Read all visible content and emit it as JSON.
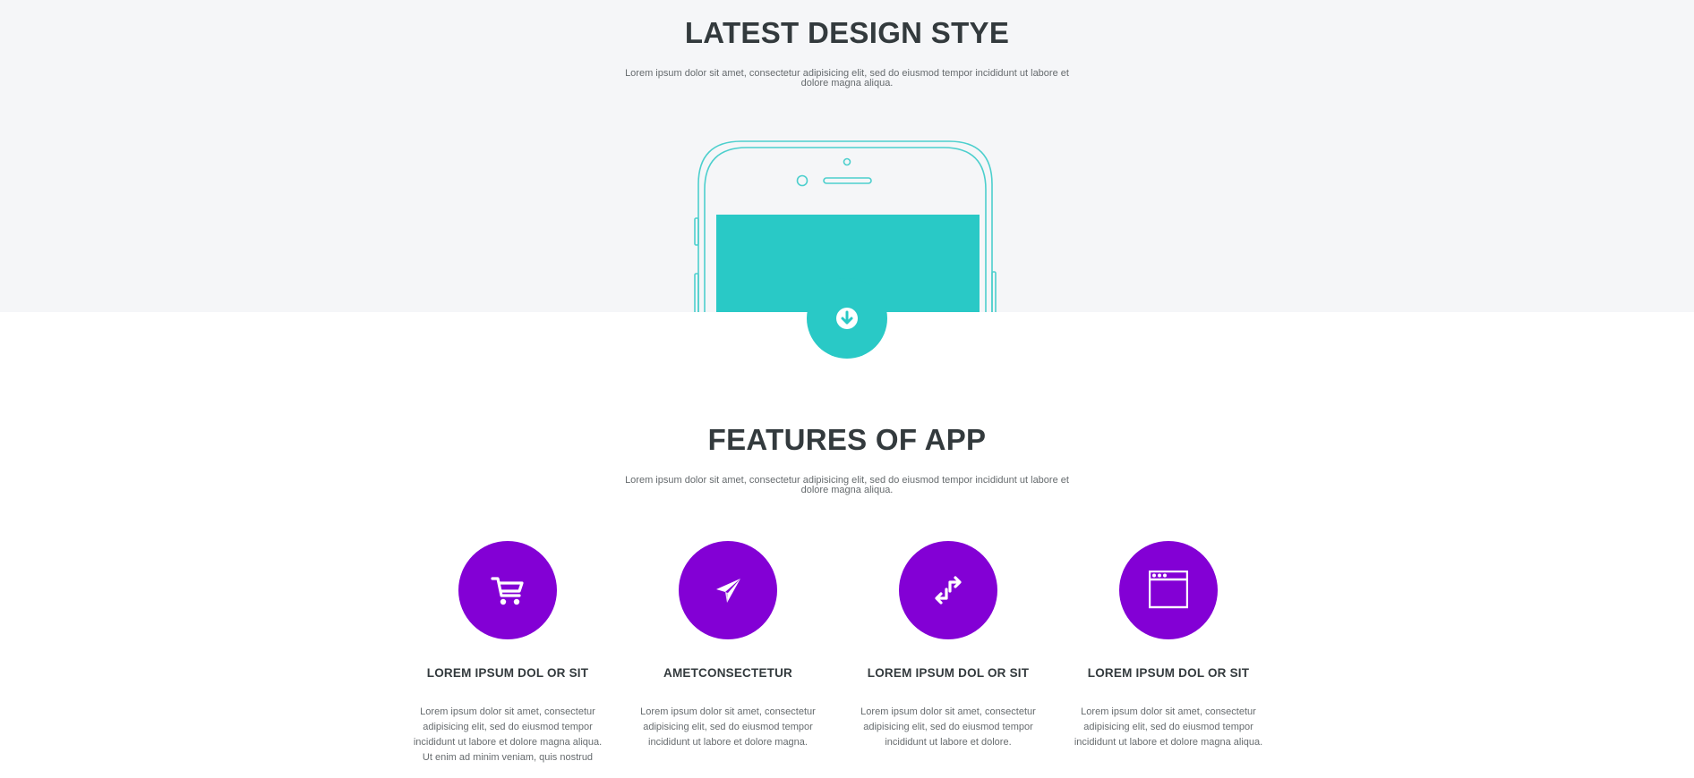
{
  "hero": {
    "title": "LATEST DESIGN STYE",
    "description": "Lorem ipsum dolor sit amet, consectetur adipisicing elit, sed do eiusmod tempor incididunt ut labore et dolore magna aliqua.",
    "phone_icon": "smartphone-outline-illustration",
    "scroll_icon": "arrow-down-circle-icon"
  },
  "features": {
    "title": "FEATURES OF APP",
    "description": "Lorem ipsum dolor sit amet, consectetur adipisicing elit, sed do eiusmod tempor incididunt ut labore et dolore magna aliqua.",
    "items": [
      {
        "icon": "shopping-cart-icon",
        "title": "LOREM IPSUM DOL OR SIT",
        "text": "Lorem ipsum dolor sit amet, consectetur adipisicing elit, sed do eiusmod tempor incididunt ut labore et dolore magna aliqua. Ut enim ad minim veniam, quis nostrud"
      },
      {
        "icon": "paper-plane-icon",
        "title": "AMETCONSECTETUR",
        "text": "Lorem ipsum dolor sit amet, consectetur adipisicing elit, sed do eiusmod tempor incididunt ut labore et dolore magna."
      },
      {
        "icon": "exchange-arrows-icon",
        "title": "LOREM IPSUM DOL OR SIT",
        "text": "Lorem ipsum dolor sit amet, consectetur adipisicing elit, sed do eiusmod tempor incididunt ut labore et dolore."
      },
      {
        "icon": "browser-window-icon",
        "title": "LOREM IPSUM DOL OR SIT",
        "text": "Lorem ipsum dolor sit amet, consectetur adipisicing elit, sed do eiusmod tempor incididunt ut labore et dolore magna aliqua."
      }
    ]
  },
  "colors": {
    "hero_background": "#f5f6f8",
    "accent_teal": "#29c9c6",
    "accent_purple": "#8300d5",
    "heading_text": "#333a3d",
    "body_text": "#666b6e"
  }
}
